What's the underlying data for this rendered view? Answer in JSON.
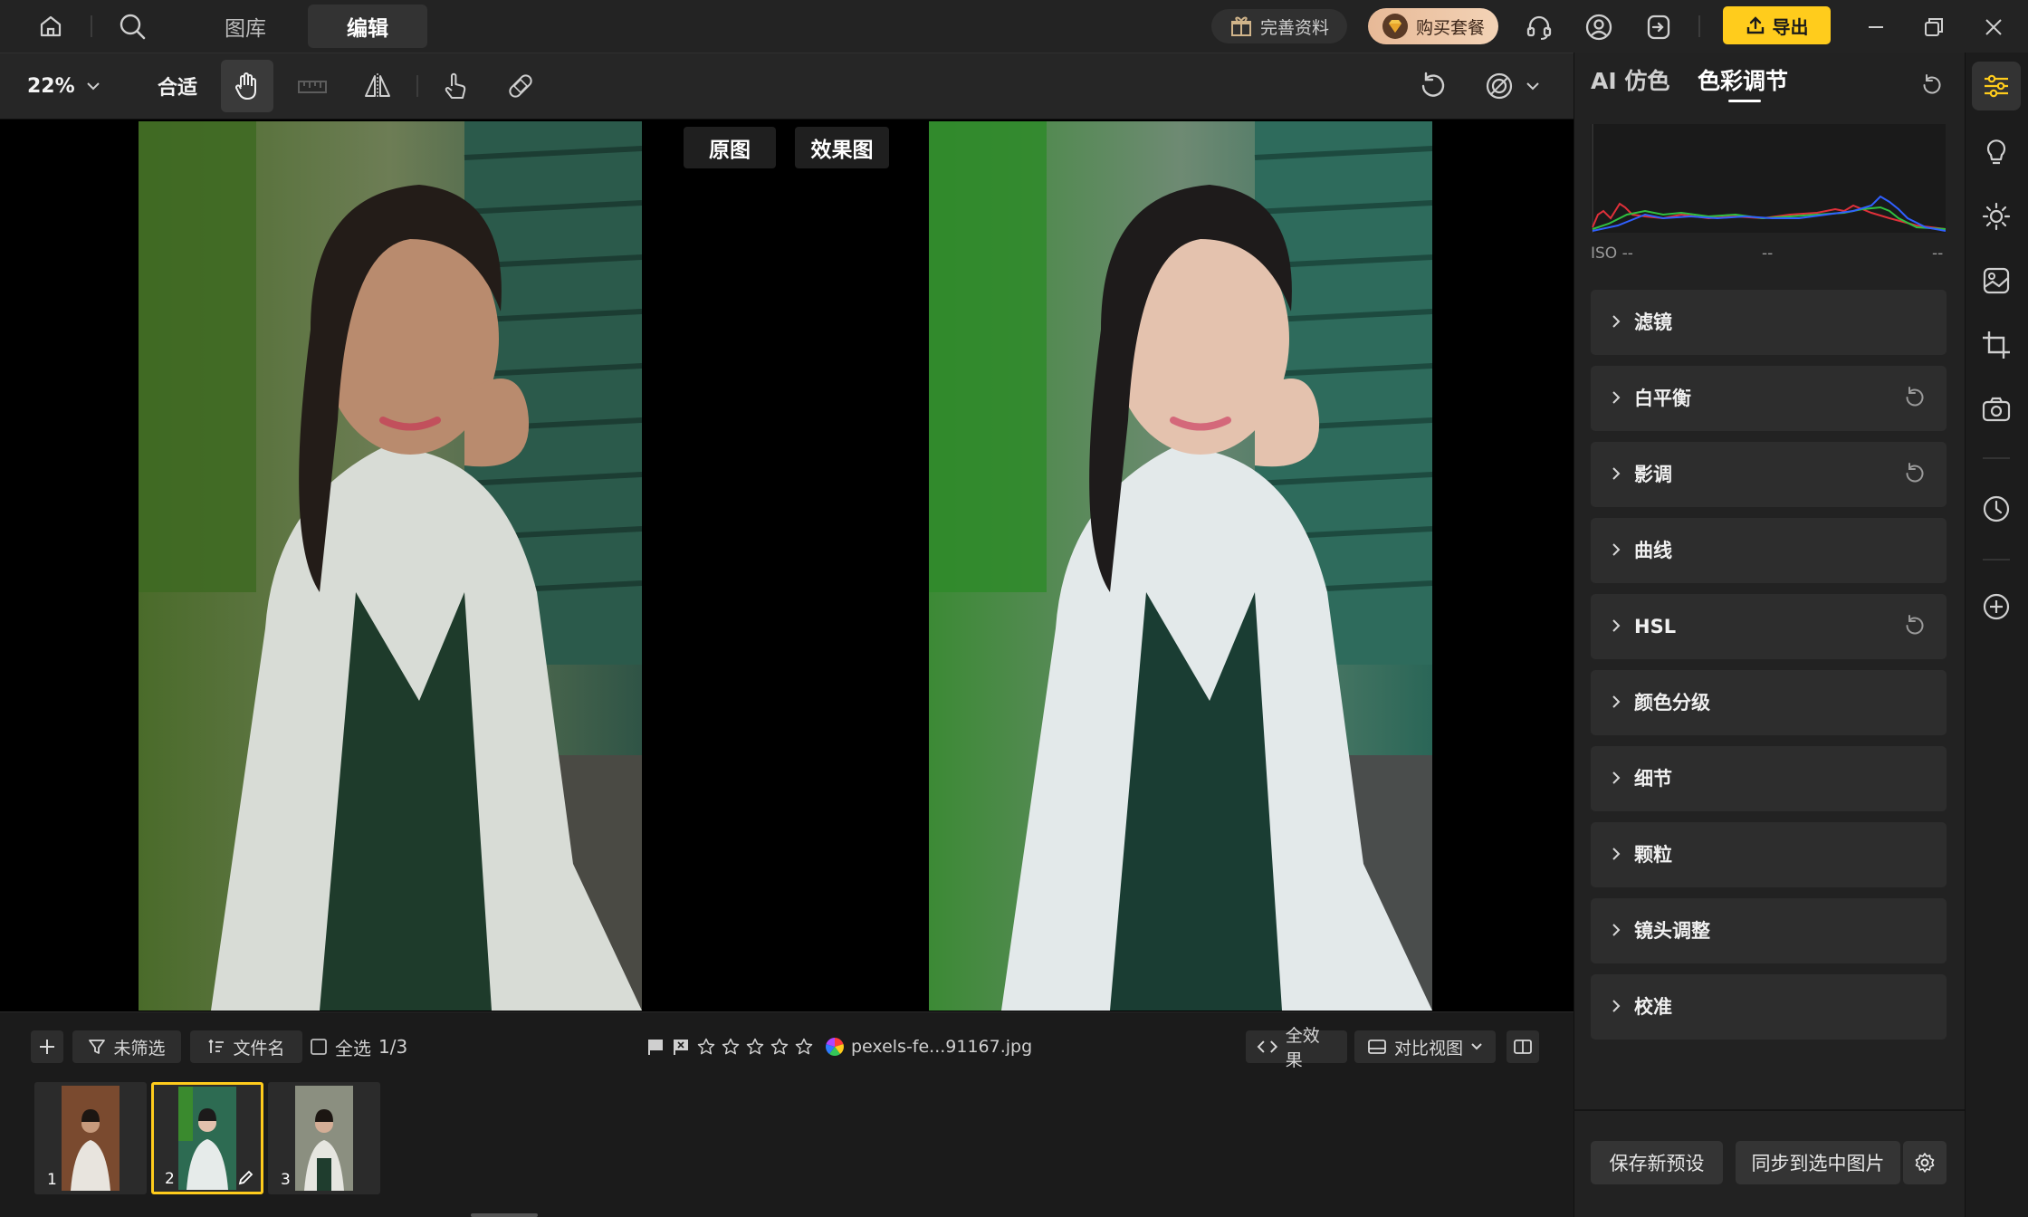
{
  "topbar": {
    "tabs": [
      {
        "label": "图库",
        "active": false
      },
      {
        "label": "编辑",
        "active": true
      }
    ],
    "profile_label": "完善资料",
    "buy_label": "购买套餐",
    "export_label": "导出"
  },
  "toolbar": {
    "zoom_value": "22%",
    "fit_label": "合适",
    "active_tool": "hand-tool"
  },
  "canvas": {
    "before_label": "原图",
    "after_label": "效果图"
  },
  "bottom": {
    "filter_label": "未筛选",
    "sort_label": "文件名",
    "select_all_label": "全选",
    "selection_count": "1/3",
    "filename": "pexels-fe...91167.jpg",
    "rating": 0,
    "effect_label": "全效果",
    "view_label": "对比视图",
    "thumbnails": [
      {
        "number": "1",
        "selected": false,
        "edited": false
      },
      {
        "number": "2",
        "selected": true,
        "edited": true
      },
      {
        "number": "3",
        "selected": false,
        "edited": false
      }
    ]
  },
  "right_panel": {
    "tabs": [
      {
        "label": "AI 仿色",
        "active": false
      },
      {
        "label": "色彩调节",
        "active": true
      }
    ],
    "histogram": {
      "iso_label": "ISO --",
      "mid_label": "--",
      "right_label": "--"
    },
    "sections": [
      {
        "label": "滤镜",
        "modified": false
      },
      {
        "label": "白平衡",
        "modified": true
      },
      {
        "label": "影调",
        "modified": true
      },
      {
        "label": "曲线",
        "modified": false
      },
      {
        "label": "HSL",
        "modified": true
      },
      {
        "label": "颜色分级",
        "modified": false
      },
      {
        "label": "细节",
        "modified": false
      },
      {
        "label": "颗粒",
        "modified": false
      },
      {
        "label": "镜头调整",
        "modified": false
      },
      {
        "label": "校准",
        "modified": false
      }
    ],
    "save_preset_label": "保存新预设",
    "sync_label": "同步到选中图片"
  },
  "colors": {
    "accent": "#ffcc1c",
    "panel": "#2d2d2d",
    "background": "#1e1e1e"
  }
}
